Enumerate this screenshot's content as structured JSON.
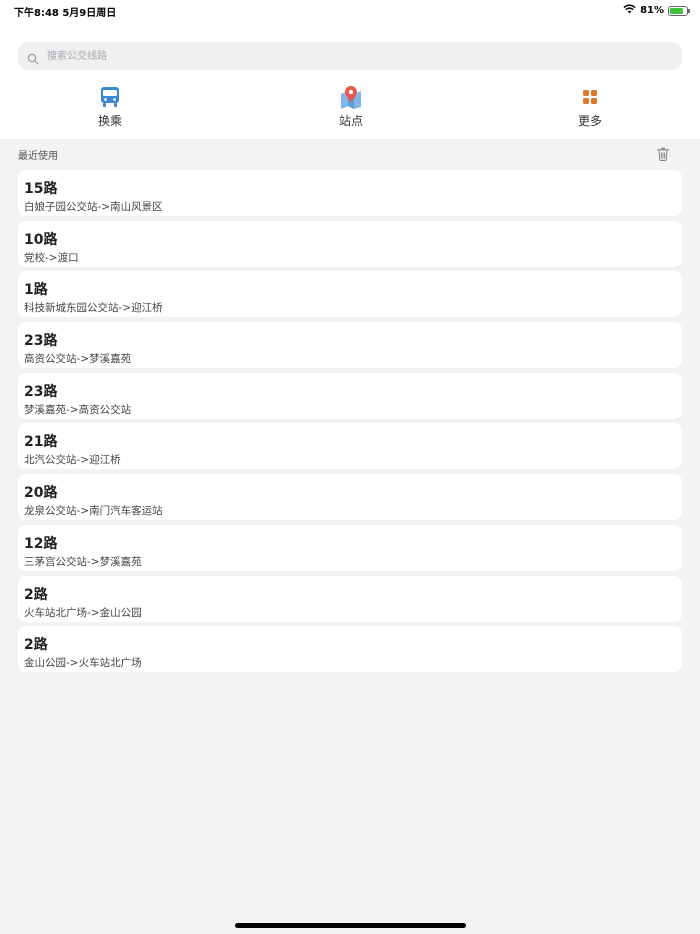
{
  "status_bar": {
    "time_date": "下午8:48   5月9日周日",
    "battery_text": "81%",
    "battery_level": 0.81,
    "icons": [
      "wifi-icon",
      "battery-icon",
      "charging-icon"
    ]
  },
  "search": {
    "placeholder": "搜索公交线路",
    "value": ""
  },
  "tabs": [
    {
      "label": "换乘",
      "icon": "bus-icon",
      "color": "#3a86d6"
    },
    {
      "label": "站点",
      "icon": "map-pin-icon",
      "color": "#e85a4f"
    },
    {
      "label": "更多",
      "icon": "grid-icon",
      "color": "#e0782f"
    }
  ],
  "recent": {
    "title": "最近使用",
    "clear_icon": "trash-icon",
    "routes": [
      {
        "name": "15路",
        "desc": "白娘子园公交站->南山风景区"
      },
      {
        "name": "10路",
        "desc": "党校->渡口"
      },
      {
        "name": "1路",
        "desc": "科技新城东园公交站->迎江桥"
      },
      {
        "name": "23路",
        "desc": "高资公交站->梦溪嘉苑"
      },
      {
        "name": "23路",
        "desc": "梦溪嘉苑->高资公交站"
      },
      {
        "name": "21路",
        "desc": "北汽公交站->迎江桥"
      },
      {
        "name": "20路",
        "desc": "龙泉公交站->南门汽车客运站"
      },
      {
        "name": "12路",
        "desc": "三茅宫公交站->梦溪嘉苑"
      },
      {
        "name": "2路",
        "desc": "火车站北广场->金山公园"
      },
      {
        "name": "2路",
        "desc": "金山公园->火车站北广场"
      }
    ]
  }
}
